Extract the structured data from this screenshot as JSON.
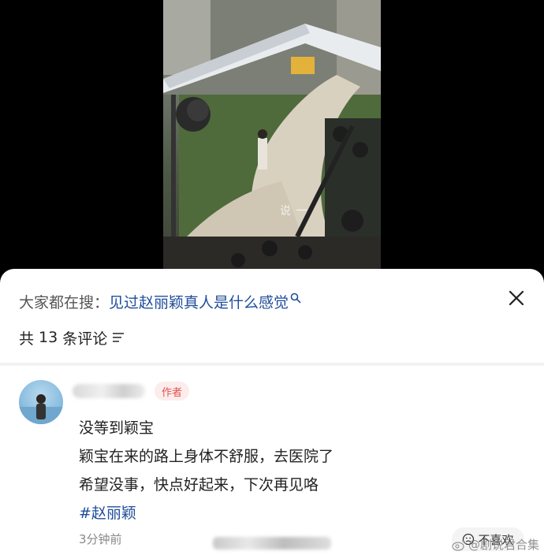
{
  "video": {
    "overlay_text": "说  一"
  },
  "sheet": {
    "search_prefix": "大家都在搜：",
    "search_query": "见过赵丽颖真人是什么感觉",
    "count_prefix": "共",
    "count_number": "13",
    "count_suffix": "条评论"
  },
  "comment": {
    "author_badge": "作者",
    "lines": [
      "没等到颖宝",
      "颖宝在来的路上身体不舒服，去医院了",
      "希望没事，快点好起来，下次再见咯"
    ],
    "hashtag": "#赵丽颖",
    "timestamp": "3分钟前",
    "dislike_label": "不喜欢"
  },
  "watermark": {
    "text": "@剧说君合集"
  },
  "colors": {
    "link_blue": "#1f4d9a",
    "author_red": "#e0524f",
    "badge_bg": "#fdecec"
  }
}
